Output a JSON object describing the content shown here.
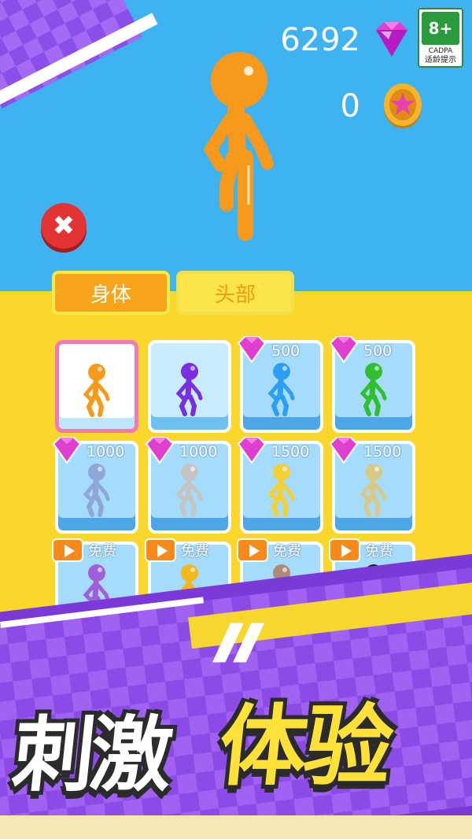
{
  "currency": {
    "gems": "6292",
    "coins": "0"
  },
  "age_rating": {
    "age": "8+",
    "org": "CADPA",
    "tip": "适龄提示"
  },
  "tabs": [
    {
      "label": "身体",
      "selected": true
    },
    {
      "label": "头部",
      "selected": false
    }
  ],
  "skins": [
    {
      "color": "#f79a1c",
      "price": "",
      "type": "owned",
      "selected": true
    },
    {
      "color": "#7a2ee0",
      "price": "",
      "type": "owned",
      "selected": false
    },
    {
      "color": "#2d9ff2",
      "price": "500",
      "type": "gem"
    },
    {
      "color": "#2fbf2f",
      "price": "500",
      "type": "gem"
    },
    {
      "color": "#8fa7d6",
      "price": "1000",
      "type": "gem"
    },
    {
      "color": "#c4c4c4",
      "price": "1000",
      "type": "gem"
    },
    {
      "color": "#f4d037",
      "price": "1500",
      "type": "gem"
    },
    {
      "color": "#d7c98a",
      "price": "1500",
      "type": "gem"
    },
    {
      "color": "#a05fd8",
      "price": "免费",
      "type": "ad"
    },
    {
      "color": "#f2b81a",
      "price": "免费",
      "type": "ad"
    },
    {
      "color": "#b08a78",
      "price": "免费",
      "type": "ad"
    },
    {
      "color": "#222222",
      "price": "免费",
      "type": "ad"
    }
  ],
  "banner": {
    "white_text": "刺激",
    "yellow_text": "体验"
  },
  "icons": [
    "gem-icon",
    "coin-icon",
    "close-icon",
    "play-icon"
  ]
}
